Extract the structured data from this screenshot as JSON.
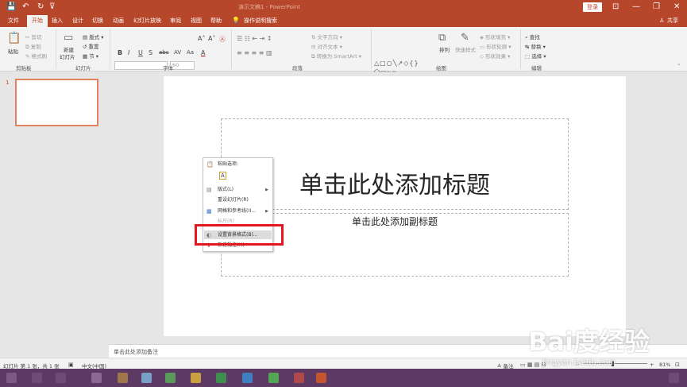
{
  "titlebar": {
    "doc_title": "演示文稿1 - PowerPoint",
    "save_icon": "💾",
    "undo_icon": "↶",
    "redo_icon": "↻",
    "customize_icon": "⊽",
    "login": "登录",
    "ribbon_opts_icon": "⊡",
    "minimize": "—",
    "restore": "❐",
    "close": "✕"
  },
  "menubar": {
    "tabs": [
      "文件",
      "开始",
      "插入",
      "设计",
      "切换",
      "动画",
      "幻灯片放映",
      "审阅",
      "视图",
      "帮助"
    ],
    "tell_me_icon": "💡",
    "tell_me": "操作说明搜索",
    "share": "共享",
    "share_icon": "♙"
  },
  "ribbon": {
    "clipboard": {
      "paste": "粘贴",
      "cut": "剪切",
      "copy": "复制",
      "format_painter": "格式刷",
      "label": "剪贴板"
    },
    "slides": {
      "new_slide_1": "新建",
      "new_slide_2": "幻灯片",
      "layout": "版式",
      "reset": "重置",
      "section": "节",
      "label": "幻灯片"
    },
    "font": {
      "size": "60",
      "label": "字体",
      "bold": "B",
      "italic": "I",
      "underline": "U",
      "strike": "S",
      "spacing": "abc",
      "shadow": "AV",
      "case": "Aa",
      "color": "A"
    },
    "paragraph": {
      "text_direction": "文字方向",
      "align_text": "对齐文本",
      "smartart": "转换为 SmartArt",
      "label": "段落"
    },
    "drawing": {
      "shapes": "△□○╲↗◇{}⬠▭⤷⌒",
      "arrange": "排列",
      "quick_styles": "快速样式",
      "fill": "形状填充",
      "outline": "形状轮廓",
      "effects": "形状效果",
      "label": "绘图"
    },
    "editing": {
      "find": "查找",
      "replace": "替换",
      "select": "选择",
      "label": "编辑"
    }
  },
  "thumbnails": {
    "number": "1"
  },
  "slide": {
    "title_placeholder": "单击此处添加标题",
    "subtitle_placeholder": "单击此处添加副标题"
  },
  "context_menu": {
    "paste_options": "粘贴选项:",
    "paste_option_icon": "A",
    "layout": "版式(L)",
    "reset": "重设幻灯片(R)",
    "grid": "网格和参考线(I)...",
    "ruler": "标尺(R)",
    "format_background": "设置背景格式(B)...",
    "new_comment": "新建批注(M)"
  },
  "notes": {
    "placeholder": "单击此处添加备注"
  },
  "statusbar": {
    "slide_info": "幻灯片 第 1 张，共 1 张",
    "language": "中文(中国)",
    "notes_btn": "备注",
    "zoom": "81%"
  },
  "watermark": {
    "main": "Bai度经验",
    "sub": "jingyan.baidu.com"
  },
  "colors": {
    "accent": "#b7472a",
    "highlight_box": "#e5161d",
    "thumb_border": "#e3825f",
    "taskbar": "#5c3a63"
  }
}
